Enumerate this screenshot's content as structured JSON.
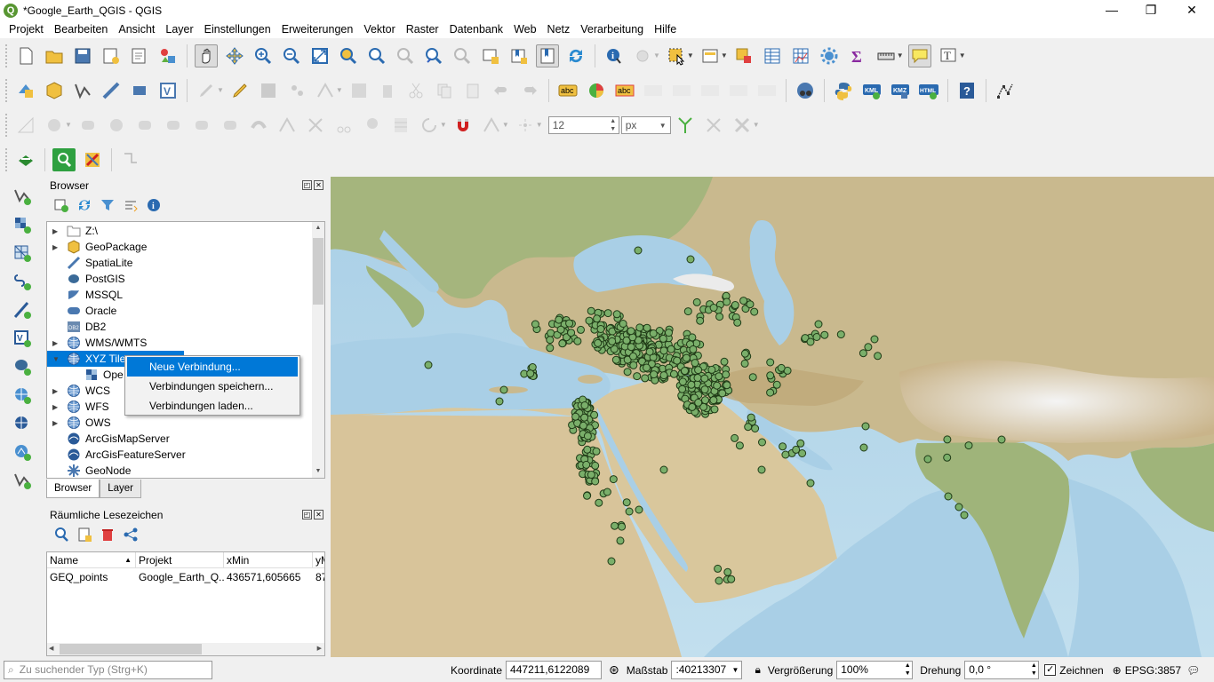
{
  "window": {
    "title": "*Google_Earth_QGIS - QGIS",
    "minimize": "—",
    "maximize": "❐",
    "close": "✕"
  },
  "menu": [
    "Projekt",
    "Bearbeiten",
    "Ansicht",
    "Layer",
    "Einstellungen",
    "Erweiterungen",
    "Vektor",
    "Raster",
    "Datenbank",
    "Web",
    "Netz",
    "Verarbeitung",
    "Hilfe"
  ],
  "toolbar": {
    "symbol_size_value": "12",
    "symbol_unit": "px",
    "kml_label": "KML",
    "kmz_label": "KMZ",
    "html_label": "HTML",
    "abc_label": "abc",
    "text_icon": "T"
  },
  "browser": {
    "title": "Browser",
    "items": [
      {
        "label": "Z:\\",
        "icon": "folder-icon",
        "arrow": "▶"
      },
      {
        "label": "GeoPackage",
        "icon": "geopackage-icon",
        "arrow": "▶"
      },
      {
        "label": "SpatiaLite",
        "icon": "spatialite-icon",
        "arrow": ""
      },
      {
        "label": "PostGIS",
        "icon": "postgis-icon",
        "arrow": ""
      },
      {
        "label": "MSSQL",
        "icon": "mssql-icon",
        "arrow": ""
      },
      {
        "label": "Oracle",
        "icon": "oracle-icon",
        "arrow": ""
      },
      {
        "label": "DB2",
        "icon": "db2-icon",
        "arrow": ""
      },
      {
        "label": "WMS/WMTS",
        "icon": "globe-icon",
        "arrow": "▶"
      },
      {
        "label": "XYZ Tiles",
        "icon": "globe-icon",
        "arrow": "▼"
      },
      {
        "label": "Ope",
        "icon": "tile-icon",
        "arrow": ""
      },
      {
        "label": "WCS",
        "icon": "globe-icon",
        "arrow": "▶"
      },
      {
        "label": "WFS",
        "icon": "globe-icon",
        "arrow": "▶"
      },
      {
        "label": "OWS",
        "icon": "globe-icon",
        "arrow": "▶"
      },
      {
        "label": "ArcGisMapServer",
        "icon": "arcgis-icon",
        "arrow": ""
      },
      {
        "label": "ArcGisFeatureServer",
        "icon": "arcgis-icon",
        "arrow": ""
      },
      {
        "label": "GeoNode",
        "icon": "geonode-icon",
        "arrow": ""
      }
    ],
    "tabs": [
      "Browser",
      "Layer"
    ]
  },
  "context_menu": [
    "Neue Verbindung...",
    "Verbindungen speichern...",
    "Verbindungen laden..."
  ],
  "bookmarks": {
    "title": "Räumliche Lesezeichen",
    "columns": [
      "Name",
      "Projekt",
      "xMin",
      "yM"
    ],
    "rows": [
      [
        "GEQ_points",
        "Google_Earth_Q...",
        "436571,605665",
        "87"
      ]
    ]
  },
  "status": {
    "search_placeholder": "Zu suchender Typ (Strg+K)",
    "coord_label": "Koordinate",
    "coord_value": "447211,6122089",
    "scale_label": "Maßstab",
    "scale_value": ":40213307",
    "zoom_label": "Vergrößerung",
    "zoom_value": "100%",
    "rotation_label": "Drehung",
    "rotation_value": "0,0 °",
    "render_label": "Zeichnen",
    "render_checked": "✓",
    "crs": "EPSG:3857"
  },
  "colors": {
    "accent": "#0078d7",
    "points": "#7aaf6a",
    "point_stroke": "#1f3a16"
  }
}
